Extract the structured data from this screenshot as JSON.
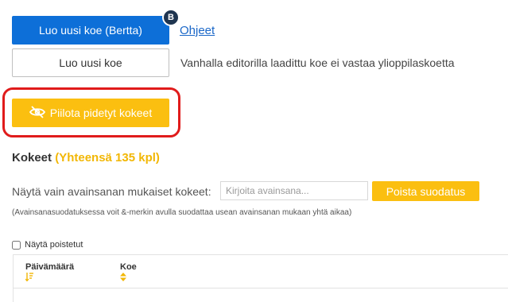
{
  "actions": {
    "new_exam_bertta": "Luo uusi koe (Bertta)",
    "bertta_badge": "B",
    "help_link": "Ohjeet",
    "new_exam_old": "Luo uusi koe",
    "old_editor_note": "Vanhalla editorilla laadittu koe ei vastaa ylioppilaskoetta",
    "hide_past": "Piilota pidetyt kokeet"
  },
  "exams": {
    "title": "Kokeet",
    "total": "(Yhteensä 135 kpl)"
  },
  "filter": {
    "label": "Näytä vain avainsanan mukaiset kokeet:",
    "placeholder": "Kirjoita avainsana...",
    "clear_button": "Poista suodatus",
    "hint": "(Avainsanasuodatuksessa voit &-merkin avulla suodattaa usean avainsanan mukaan yhtä aikaa)"
  },
  "show_deleted": {
    "label": "Näytä poistetut",
    "checked": false
  },
  "table": {
    "columns": [
      {
        "label": "Päivämäärä",
        "sort_icon": "sort-desc-icon"
      },
      {
        "label": "Koe",
        "sort_icon": "sort-both-icon"
      }
    ]
  },
  "colors": {
    "primary": "#0d6fd8",
    "accent": "#fbbf10",
    "highlight": "#e01b1b"
  }
}
